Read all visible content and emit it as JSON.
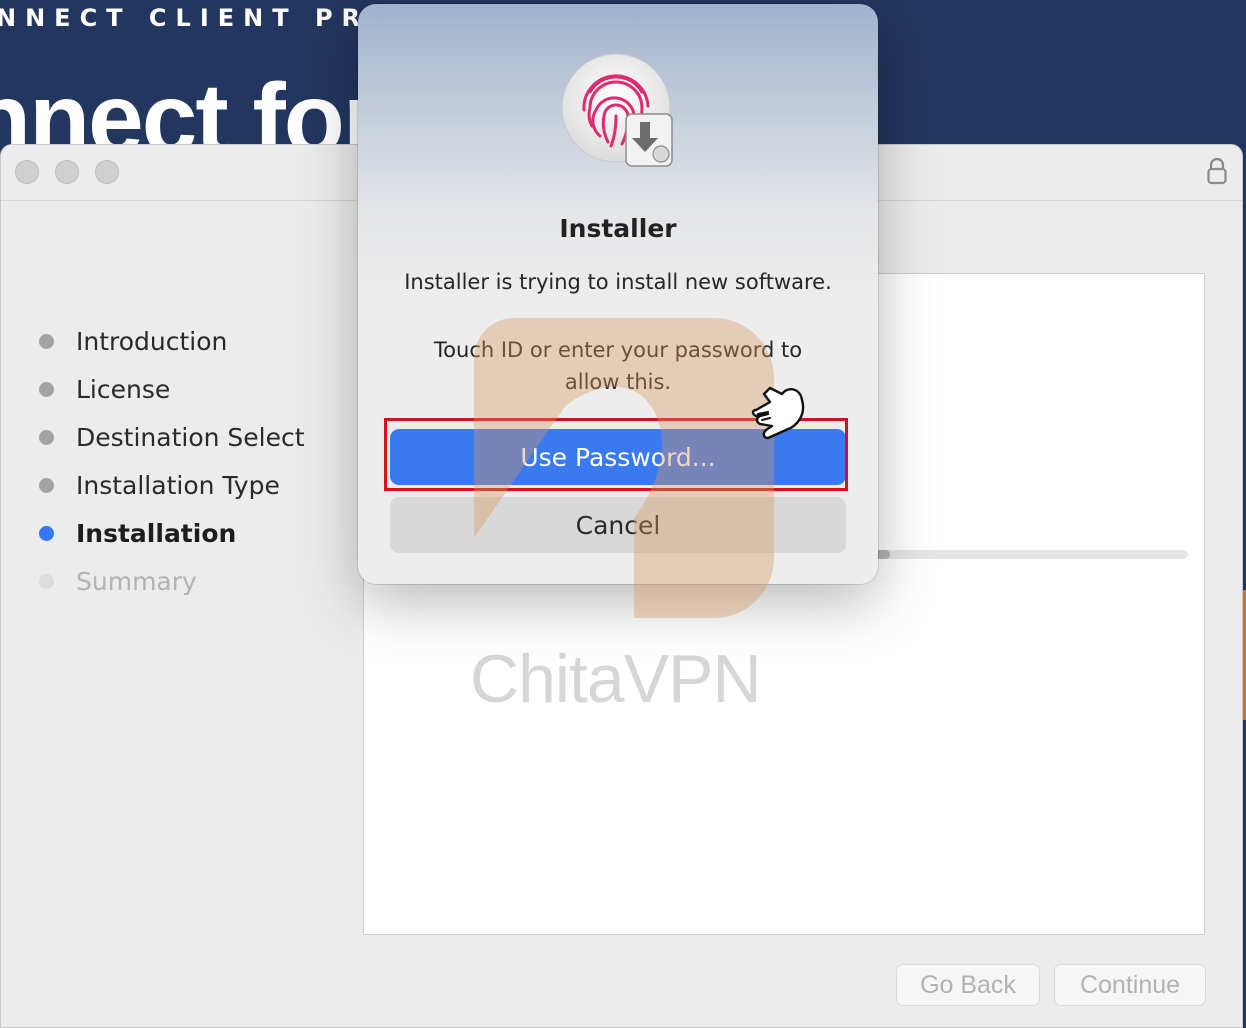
{
  "background": {
    "subtitle": "NNECT CLIENT PROGRAM",
    "headline": "nnect for"
  },
  "window": {
    "sidebar_steps": [
      {
        "label": "Introduction",
        "state": "done"
      },
      {
        "label": "License",
        "state": "done"
      },
      {
        "label": "Destination Select",
        "state": "done"
      },
      {
        "label": "Installation Type",
        "state": "done"
      },
      {
        "label": "Installation",
        "state": "active"
      },
      {
        "label": "Summary",
        "state": "pending"
      }
    ],
    "buttons": {
      "go_back": "Go Back",
      "continue": "Continue"
    }
  },
  "dialog": {
    "title": "Installer",
    "message": "Installer is trying to install new software.",
    "prompt": "Touch ID or enter your password to allow this.",
    "primary_button": "Use Password...",
    "cancel_button": "Cancel",
    "icon": "touch-id-installer-icon"
  },
  "watermark": {
    "text": "ChitaVPN"
  },
  "colors": {
    "accent": "#3a7af0",
    "highlight": "#d0161c",
    "header_bg": "#23365f"
  }
}
